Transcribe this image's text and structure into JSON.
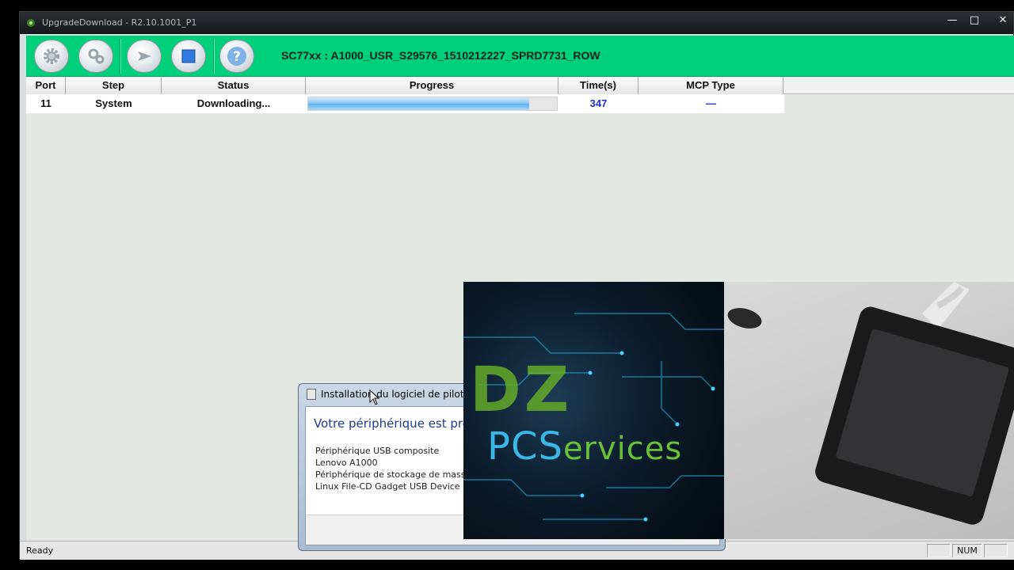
{
  "window": {
    "title": "UpgradeDownload - R2.10.1001_P1",
    "controls": {
      "minimize": "—",
      "maximize": "□",
      "close": "✕"
    }
  },
  "toolbar": {
    "buttons": [
      {
        "icon": "gear-icon"
      },
      {
        "icon": "gears-icon"
      },
      {
        "icon": "play-icon"
      },
      {
        "icon": "stop-icon"
      },
      {
        "icon": "help-icon",
        "label": "?"
      }
    ],
    "firmware_label": "SC77xx : A1000_USR_S29576_1510212227_SPRD7731_ROW"
  },
  "table": {
    "headers": [
      "Port",
      "Step",
      "Status",
      "Progress",
      "Time(s)",
      "MCP Type"
    ],
    "rows": [
      {
        "port": "11",
        "step": "System",
        "status": "Downloading...",
        "progress": 0.89,
        "time": "347",
        "mcp_type": "—"
      }
    ]
  },
  "statusbar": {
    "ready": "Ready",
    "num": "NUM"
  },
  "dialog": {
    "title": "Installation du logiciel de pilote",
    "headline": "Votre périphérique est prêt",
    "devices": [
      "Périphérique USB composite",
      "Lenovo A1000",
      "Périphérique de stockage de masse",
      "Linux File-CD Gadget USB Device"
    ]
  },
  "overlay": {
    "logo_line1": "DZ",
    "logo_pc": "PCS",
    "logo_ervices": "ervices"
  },
  "colors": {
    "toolbar_green": "#00d07a",
    "link_blue": "#1a2fd0"
  }
}
